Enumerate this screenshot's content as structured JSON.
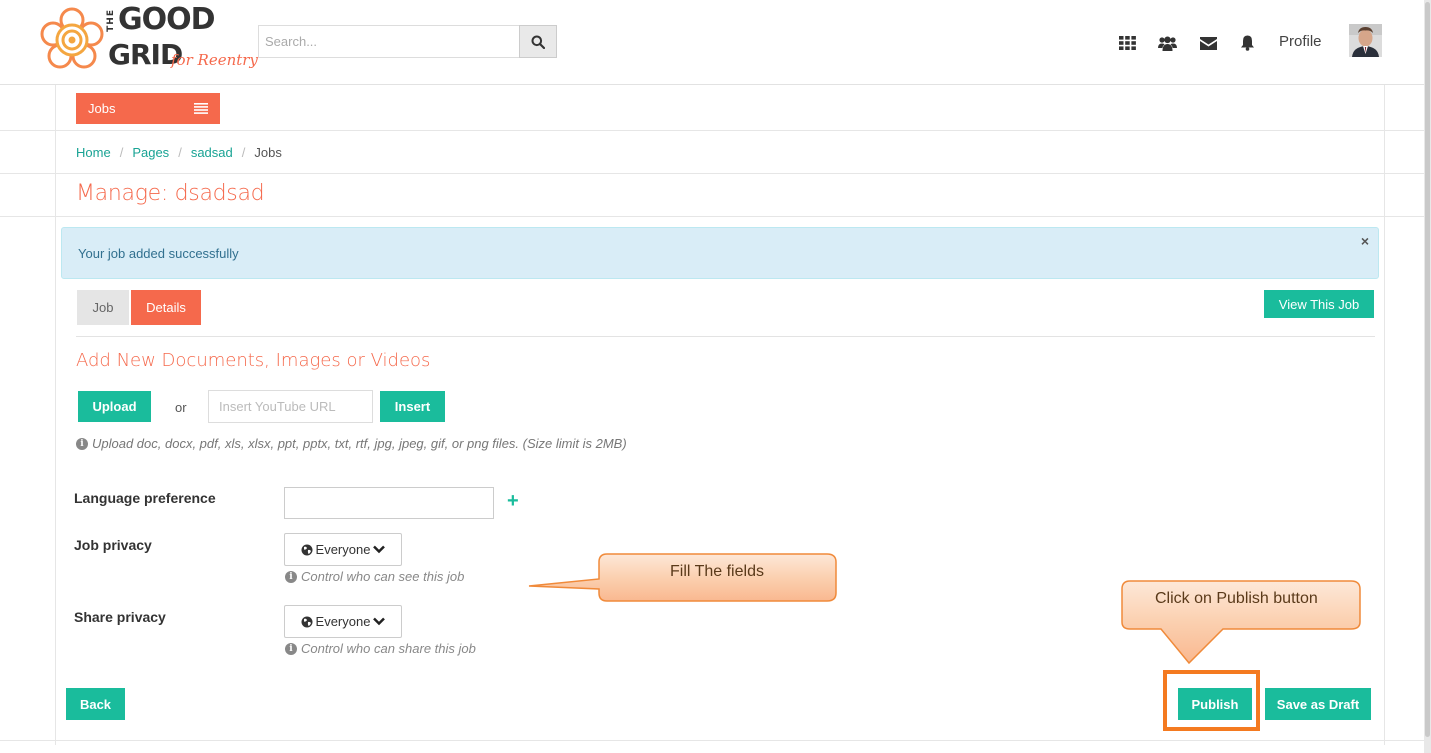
{
  "header": {
    "logo": {
      "line1": "THE",
      "line2": "GOOD",
      "line3": "GRID",
      "tagline": "for Reentry"
    },
    "search": {
      "placeholder": "Search..."
    },
    "icons": [
      "apps-grid-icon",
      "users-icon",
      "envelope-icon",
      "bell-icon",
      "search-icon"
    ],
    "profile_label": "Profile"
  },
  "nav": {
    "menu_label": "Jobs"
  },
  "breadcrumb": {
    "items": [
      "Home",
      "Pages",
      "sadsad"
    ],
    "active": "Jobs"
  },
  "page": {
    "title": "Manage: dsadsad"
  },
  "alert": {
    "message": "Your job added successfully",
    "close": "×"
  },
  "tabs": [
    {
      "label": "Job",
      "active": false
    },
    {
      "label": "Details",
      "active": true
    }
  ],
  "view_job_label": "View This Job",
  "media": {
    "title": "Add New Documents, Images or Videos",
    "upload_label": "Upload",
    "or_label": "or",
    "youtube_placeholder": "Insert YouTube URL",
    "insert_label": "Insert",
    "help": "Upload doc, docx, pdf, xls, xlsx, ppt, pptx, txt, rtf, jpg, jpeg, gif, or png files. (Size limit is 2MB)"
  },
  "form": {
    "language_label": "Language preference",
    "language_value": "",
    "add_symbol": "+",
    "job_privacy_label": "Job privacy",
    "job_privacy_value": "Everyone",
    "job_privacy_help": "Control who can see this job",
    "share_privacy_label": "Share privacy",
    "share_privacy_value": "Everyone",
    "share_privacy_help": "Control who can share this job"
  },
  "actions": {
    "back_label": "Back",
    "publish_label": "Publish",
    "draft_label": "Save as Draft"
  },
  "annotations": {
    "fill_fields": "Fill The fields",
    "click_publish": "Click on Publish button"
  },
  "colors": {
    "accent": "#f5694c",
    "teal": "#1abc9c",
    "link": "#19a394",
    "alert_bg": "#d9edf7",
    "callout_border": "#f47a20"
  }
}
